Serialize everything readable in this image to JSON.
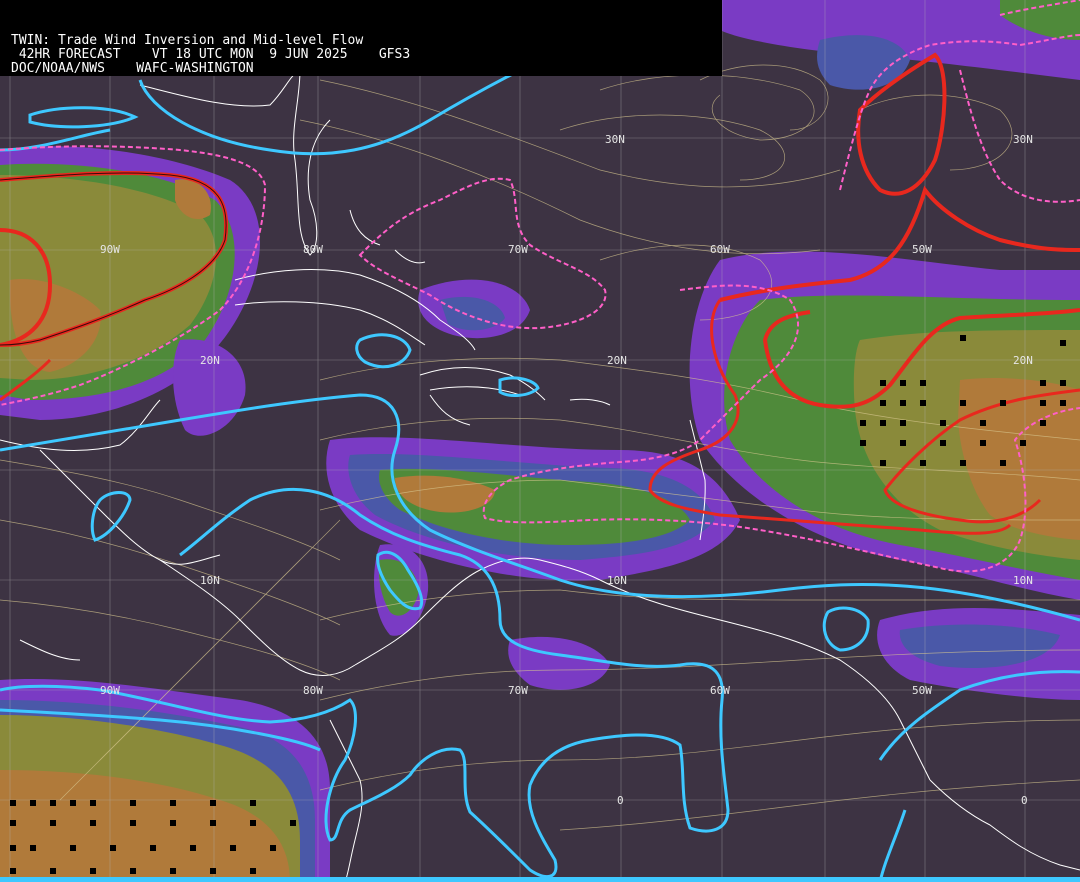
{
  "header": {
    "line1": "TWIN: Trade Wind Inversion and Mid-level Flow",
    "line2": " 42HR FORECAST    VT 18 UTC MON  9 JUN 2025    GFS3",
    "line3": "DOC/NOAA/NWS    WAFC-WASHINGTON"
  },
  "grid_labels": {
    "lat_30n_a": "30N",
    "lat_30n_b": "30N",
    "lon_90w_a": "90W",
    "lon_80w_a": "80W",
    "lon_70w_a": "70W",
    "lon_60w_a": "60W",
    "lon_50w_a": "50W",
    "lat_20n_a": "20N",
    "lat_20n_b": "20N",
    "lat_20n_c": "20N",
    "lat_10n_a": "10N",
    "lat_10n_b": "10N",
    "lat_10n_c": "10N",
    "lon_90w_b": "90W",
    "lon_80w_b": "80W",
    "lon_70w_b": "70W",
    "lon_60w_b": "60W",
    "lon_50w_b": "50W",
    "lat_0_a": "0",
    "lat_0_b": "0"
  },
  "colors": {
    "background": "#3d3343",
    "purple": "#7a3bc4",
    "blue_band": "#4a58a8",
    "green": "#4f8a3a",
    "olive": "#8a8a3a",
    "orange": "#b07a3a",
    "cyan_contour": "#3ec8ff",
    "red_contour": "#e8281e",
    "pink_dashed": "#ff5fc8",
    "streamline": "#d8c890",
    "coast": "#ffffff",
    "grid": "#b4b4b4"
  }
}
